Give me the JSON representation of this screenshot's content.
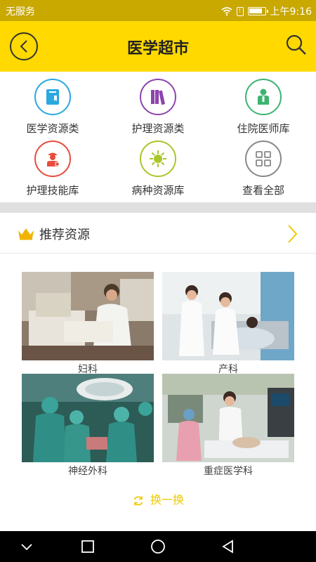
{
  "status_bar": {
    "carrier": "无服务",
    "time": "上午9:16"
  },
  "header": {
    "title": "医学超市"
  },
  "categories": [
    {
      "label": "医学资源类",
      "color": "#2aa8e0",
      "icon": "book-icon"
    },
    {
      "label": "护理资源类",
      "color": "#8e44ad",
      "icon": "books-icon"
    },
    {
      "label": "住院医师库",
      "color": "#3cb371",
      "icon": "doctor-icon"
    },
    {
      "label": "护理技能库",
      "color": "#e74c3c",
      "icon": "nurse-icon"
    },
    {
      "label": "病种资源库",
      "color": "#a8c62a",
      "icon": "virus-icon"
    },
    {
      "label": "查看全部",
      "color": "#888888",
      "icon": "grid-icon"
    }
  ],
  "recommend": {
    "title": "推荐资源",
    "items": [
      {
        "caption": "妇科"
      },
      {
        "caption": "产科"
      },
      {
        "caption": "神经外科"
      },
      {
        "caption": "重症医学科"
      }
    ],
    "refresh_label": "换一换"
  },
  "colors": {
    "brand_yellow": "#ffd900",
    "status_bar": "#c9a800",
    "accent": "#f0c800"
  }
}
